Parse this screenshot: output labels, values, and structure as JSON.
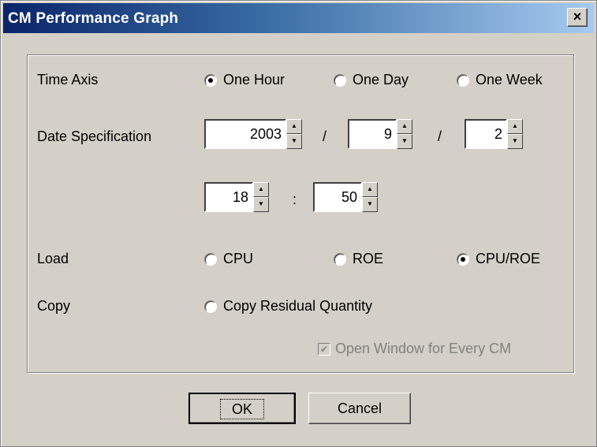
{
  "window": {
    "title": "CM Performance Graph",
    "close_glyph": "×",
    "close_icon": "close-icon"
  },
  "time_axis": {
    "label": "Time Axis",
    "options": [
      "One Hour",
      "One Day",
      "One Week"
    ],
    "selected": "One Hour"
  },
  "date_spec": {
    "label": "Date Specification",
    "year": "2003",
    "month": "9",
    "day": "2",
    "separator": "/",
    "hour": "18",
    "minute": "50",
    "time_separator": ":"
  },
  "load": {
    "label": "Load",
    "options": [
      "CPU",
      "ROE",
      "CPU/ROE"
    ],
    "selected": "CPU/ROE"
  },
  "copy": {
    "label": "Copy",
    "option": "Copy Residual Quantity"
  },
  "open_window_checkbox": {
    "label": "Open Window for Every CM",
    "checked": true,
    "enabled": false
  },
  "buttons": {
    "ok": "OK",
    "cancel": "Cancel"
  },
  "spinner_glyphs": {
    "up": "▲",
    "down": "▼"
  },
  "colors": {
    "titlebar_start": "#0a246a",
    "titlebar_end": "#a6caf0",
    "face": "#d4d0c8"
  }
}
